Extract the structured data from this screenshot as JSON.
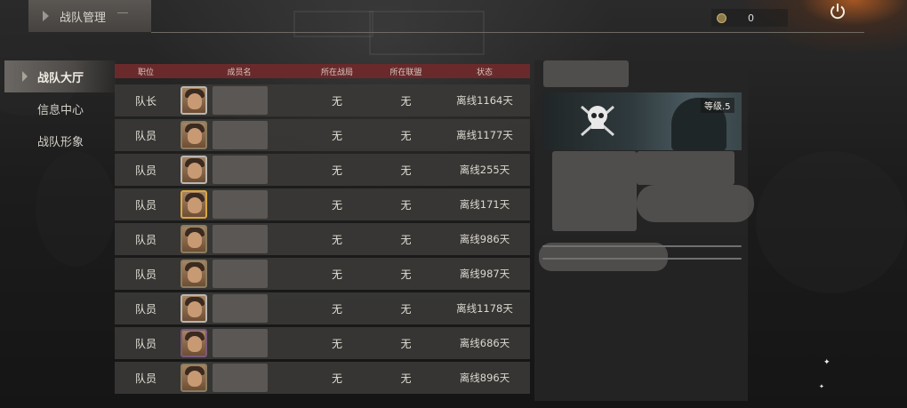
{
  "header": {
    "title": "战队管理",
    "currency_value": "0"
  },
  "sidebar": {
    "items": [
      {
        "label": "战队大厅",
        "active": true
      },
      {
        "label": "信息中心",
        "active": false
      },
      {
        "label": "战队形象",
        "active": false
      }
    ]
  },
  "table": {
    "columns": [
      "职位",
      "成员名",
      "所在战局",
      "所在联盟",
      "状态"
    ],
    "rows": [
      {
        "role": "队长",
        "zone": "无",
        "union": "无",
        "status": "离线1164天",
        "frame": "silver"
      },
      {
        "role": "队员",
        "zone": "无",
        "union": "无",
        "status": "离线1177天",
        "frame": "default"
      },
      {
        "role": "队员",
        "zone": "无",
        "union": "无",
        "status": "离线255天",
        "frame": "silver"
      },
      {
        "role": "队员",
        "zone": "无",
        "union": "无",
        "status": "离线171天",
        "frame": "gold"
      },
      {
        "role": "队员",
        "zone": "无",
        "union": "无",
        "status": "离线986天",
        "frame": "default"
      },
      {
        "role": "队员",
        "zone": "无",
        "union": "无",
        "status": "离线987天",
        "frame": "default"
      },
      {
        "role": "队员",
        "zone": "无",
        "union": "无",
        "status": "离线1178天",
        "frame": "silver"
      },
      {
        "role": "队员",
        "zone": "无",
        "union": "无",
        "status": "离线686天",
        "frame": "purple"
      },
      {
        "role": "队员",
        "zone": "无",
        "union": "无",
        "status": "离线896天",
        "frame": "default"
      }
    ]
  },
  "panel": {
    "level_label": "等级.5"
  },
  "colors": {
    "table_header": "#6a2a2c",
    "row_bg": "#3a3836",
    "active_nav": "#6b6763",
    "gold_frame": "#d9a742"
  },
  "icons": [
    "chevron-right-icon",
    "coin-icon",
    "power-icon",
    "skull-emblem-icon",
    "sparkle-icon"
  ]
}
